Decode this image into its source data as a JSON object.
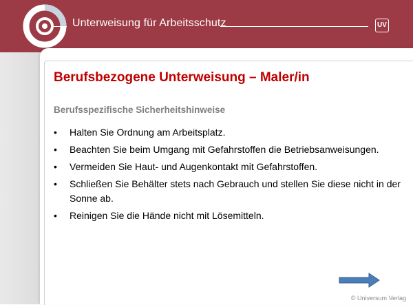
{
  "header": {
    "title": "Unterweisung für Arbeitsschutz",
    "badge": "UV",
    "background_color": "#9c3b45"
  },
  "slide": {
    "title": "Berufsbezogene Unterweisung – Maler/in",
    "title_color": "#c00000",
    "section_heading": "Berufsspezifische Sicherheitshinweise",
    "bullet_symbol": "•",
    "bullets": [
      "Halten Sie Ordnung am Arbeitsplatz.",
      "Beachten Sie beim Umgang mit Gefahrstoffen die Betriebsanweisungen.",
      "Vermeiden Sie Haut- und Augenkontakt mit Gefahrstoffen.",
      "Schließen Sie Behälter stets nach Gebrauch und stellen Sie diese nicht in der Sonne ab.",
      "Reinigen Sie die Hände nicht mit Lösemitteln."
    ]
  },
  "navigation": {
    "next_icon": "arrow-right-icon",
    "arrow_color": "#4a7ebb"
  },
  "footer": {
    "copyright": "© Universum Verlag"
  }
}
